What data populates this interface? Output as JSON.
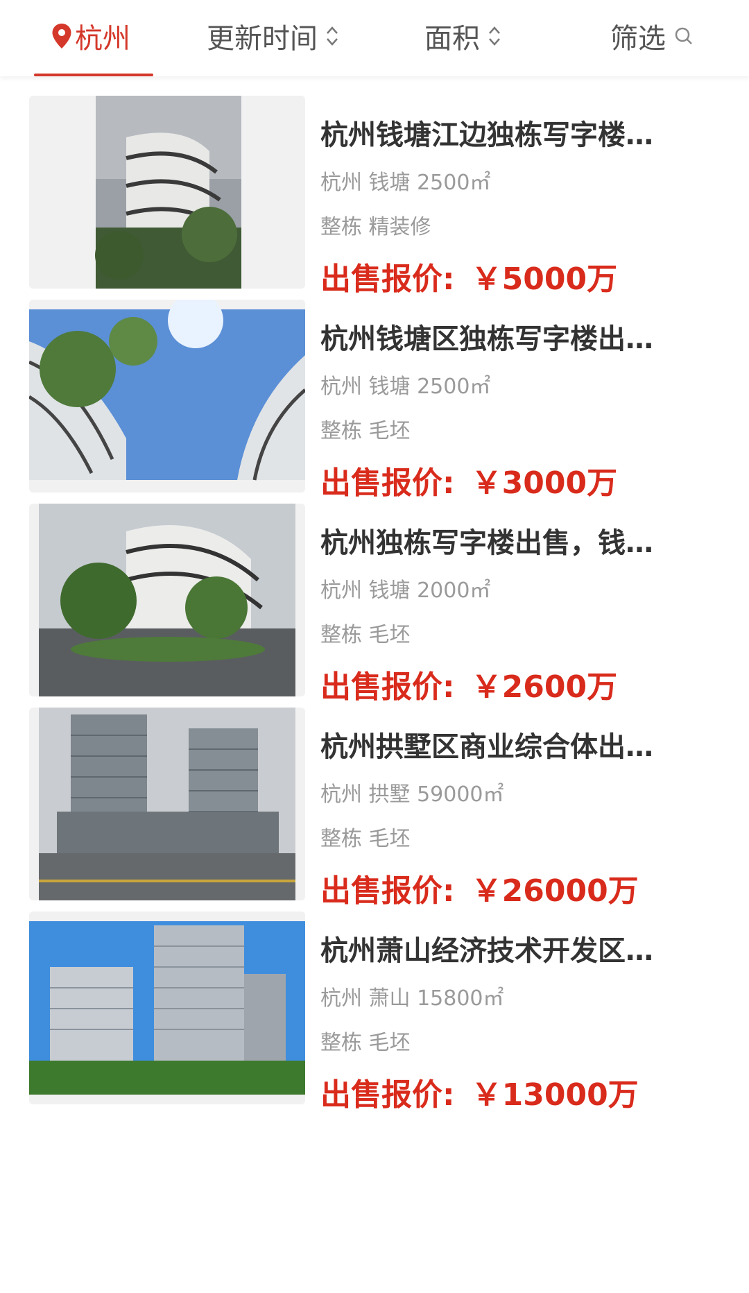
{
  "header": {
    "city": "杭州",
    "sort_update": "更新时间",
    "sort_area": "面积",
    "filter": "筛选"
  },
  "listings": [
    {
      "title": "杭州钱塘江边独栋写字楼…",
      "location": "杭州 钱塘 2500㎡",
      "detail": "整栋 精装修",
      "price_label": "出售报价:",
      "price": "￥5000万"
    },
    {
      "title": "杭州钱塘区独栋写字楼出…",
      "location": "杭州 钱塘 2500㎡",
      "detail": "整栋 毛坯",
      "price_label": "出售报价:",
      "price": "￥3000万"
    },
    {
      "title": "杭州独栋写字楼出售，钱…",
      "location": "杭州 钱塘 2000㎡",
      "detail": "整栋 毛坯",
      "price_label": "出售报价:",
      "price": "￥2600万"
    },
    {
      "title": "杭州拱墅区商业综合体出…",
      "location": "杭州 拱墅 59000㎡",
      "detail": "整栋 毛坯",
      "price_label": "出售报价:",
      "price": "￥26000万"
    },
    {
      "title": "杭州萧山经济技术开发区…",
      "location": "杭州 萧山 15800㎡",
      "detail": "整栋 毛坯",
      "price_label": "出售报价:",
      "price": "￥13000万"
    }
  ],
  "colors": {
    "accent": "#d4382b",
    "price": "#d92b1c"
  }
}
